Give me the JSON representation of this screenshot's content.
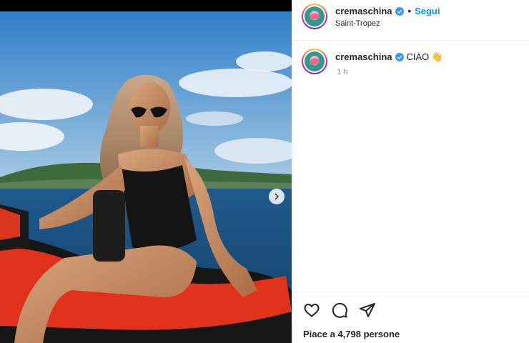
{
  "post": {
    "username": "cremaschina",
    "follow_label": "Segui",
    "separator": "•",
    "location": "Saint-Tropez"
  },
  "caption": {
    "username": "cremaschina",
    "text": "CIAO",
    "emoji": "👋",
    "time": "1 h"
  },
  "actions": {
    "icons": [
      "heart-icon",
      "comment-icon",
      "share-icon"
    ]
  },
  "likes": {
    "text": "Piace a 4,798 persone"
  },
  "colors": {
    "accent": "#0095f6",
    "verified": "#3897f0",
    "text": "#262626",
    "muted": "#8e8e8e"
  }
}
